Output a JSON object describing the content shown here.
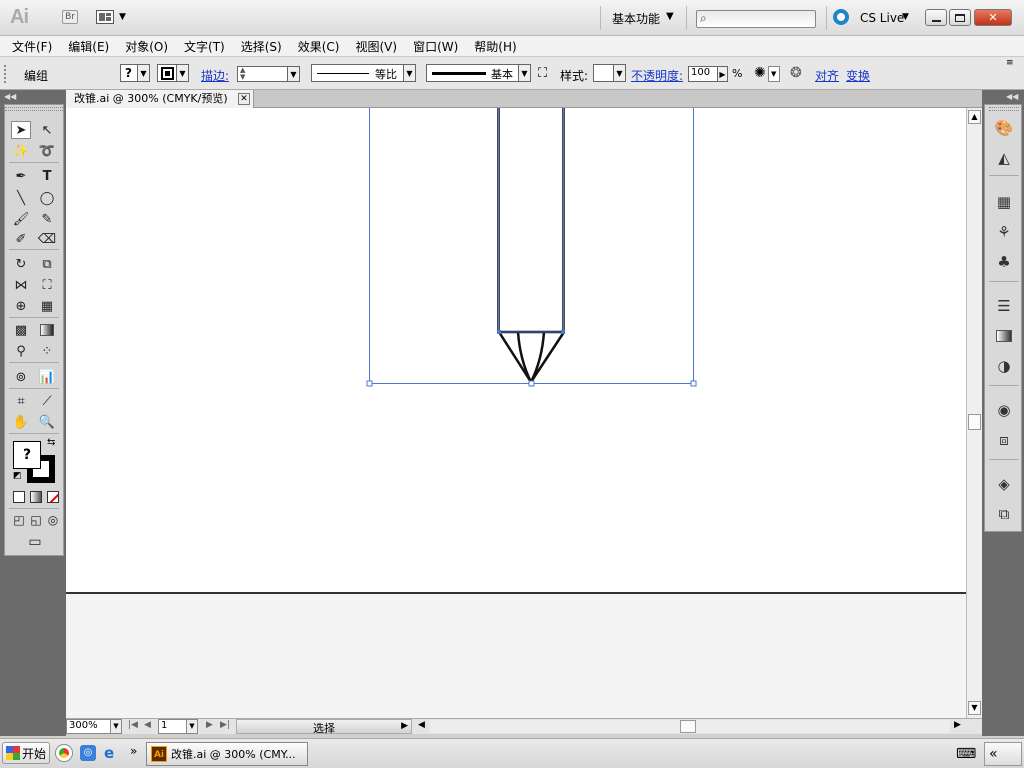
{
  "titlebar": {
    "app_logo": "Ai",
    "bridge_label": "Br",
    "workspace": "基本功能",
    "cs_live": "CS Live",
    "minimize": "▭",
    "restore": "▣",
    "close": "✕"
  },
  "menu": [
    "文件(F)",
    "编辑(E)",
    "对象(O)",
    "文字(T)",
    "选择(S)",
    "效果(C)",
    "视图(V)",
    "窗口(W)",
    "帮助(H)"
  ],
  "control": {
    "selection_type": "编组",
    "fill_value": "?",
    "stroke_label": "描边:",
    "stroke_weight": "",
    "profile": "等比",
    "brush": "基本",
    "style_label": "样式:",
    "opacity_label": "不透明度:",
    "opacity_value": "100",
    "opacity_unit": "%",
    "align_label": "对齐",
    "transform_label": "变换"
  },
  "document": {
    "tab_title": "改锥.ai @ 300% (CMYK/预览)",
    "tab_close": "✕"
  },
  "toolbox": {
    "fill_swatch": "?"
  },
  "status": {
    "zoom": "300%",
    "artboard_number": "1",
    "status_text": "选择"
  },
  "taskbar": {
    "start": "开始",
    "task_label": "改锥.ai @ 300% (CMY...",
    "overflow": "»",
    "right_chevrons": "«"
  },
  "colors": {
    "selection": "#4a78d0",
    "close_button": "#c0321a",
    "cs_live": "#1c86c8"
  }
}
